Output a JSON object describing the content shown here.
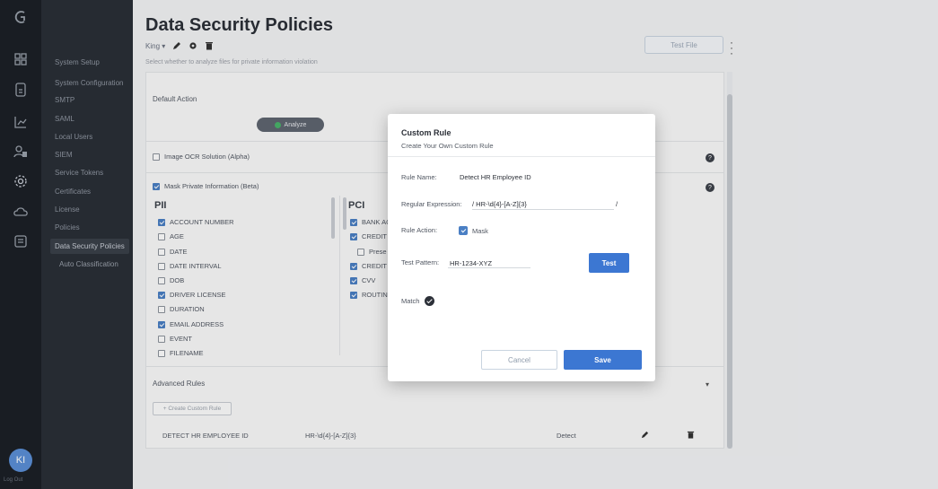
{
  "sidebar": {
    "items": [
      {
        "label": "System Setup"
      },
      {
        "label": "System Configuration"
      },
      {
        "label": "SMTP"
      },
      {
        "label": "SAML"
      },
      {
        "label": "Local Users"
      },
      {
        "label": "SIEM"
      },
      {
        "label": "Service Tokens"
      },
      {
        "label": "Certificates"
      },
      {
        "label": "License"
      },
      {
        "label": "Policies"
      },
      {
        "label": "Data Security Policies"
      },
      {
        "label": "Auto Classification"
      }
    ],
    "avatar_initials": "KI",
    "logout_label": "Log Out"
  },
  "page": {
    "title": "Data Security Policies",
    "policy_name": "King",
    "description": "Select whether to analyze files for private information violation",
    "test_file_label": "Test File"
  },
  "default_action": {
    "label": "Default Action",
    "button_label": "Analyze"
  },
  "ocr": {
    "label": "Image OCR Solution (Alpha)",
    "checked": false
  },
  "mask": {
    "label": "Mask Private Information (Beta)",
    "checked": true
  },
  "pii": {
    "heading": "PII",
    "items": [
      {
        "label": "ACCOUNT NUMBER",
        "checked": true
      },
      {
        "label": "AGE",
        "checked": false
      },
      {
        "label": "DATE",
        "checked": false
      },
      {
        "label": "DATE INTERVAL",
        "checked": false
      },
      {
        "label": "DOB",
        "checked": false
      },
      {
        "label": "DRIVER LICENSE",
        "checked": true
      },
      {
        "label": "DURATION",
        "checked": false
      },
      {
        "label": "EMAIL ADDRESS",
        "checked": true
      },
      {
        "label": "EVENT",
        "checked": false
      },
      {
        "label": "FILENAME",
        "checked": false
      }
    ]
  },
  "pci": {
    "heading": "PCI",
    "items": [
      {
        "label": "BANK AC",
        "checked": true
      },
      {
        "label": "CREDIT",
        "checked": true
      },
      {
        "label": "Prese",
        "checked": false
      },
      {
        "label": "CREDIT",
        "checked": true
      },
      {
        "label": "CVV",
        "checked": true
      },
      {
        "label": "ROUTIN",
        "checked": true
      }
    ]
  },
  "advanced": {
    "label": "Advanced Rules",
    "create_label": "+ Create Custom Rule",
    "rules": [
      {
        "name": "DETECT HR EMPLOYEE ID",
        "regex": "HR-\\d{4}-[A-Z]{3}",
        "action": "Detect"
      }
    ]
  },
  "modal": {
    "title": "Custom Rule",
    "subtitle": "Create Your Own Custom Rule",
    "rule_name_label": "Rule Name:",
    "rule_name_value": "Detect HR Employee ID",
    "regex_label": "Regular Expression:",
    "regex_value": "/ HR-\\d{4}-[A-Z]{3}",
    "regex_close": "/",
    "action_label": "Rule Action:",
    "action_option": "Mask",
    "test_pattern_label": "Test Pattern:",
    "test_pattern_value": "HR-1234-XYZ",
    "test_label": "Test",
    "match_label": "Match",
    "cancel_label": "Cancel",
    "save_label": "Save"
  }
}
